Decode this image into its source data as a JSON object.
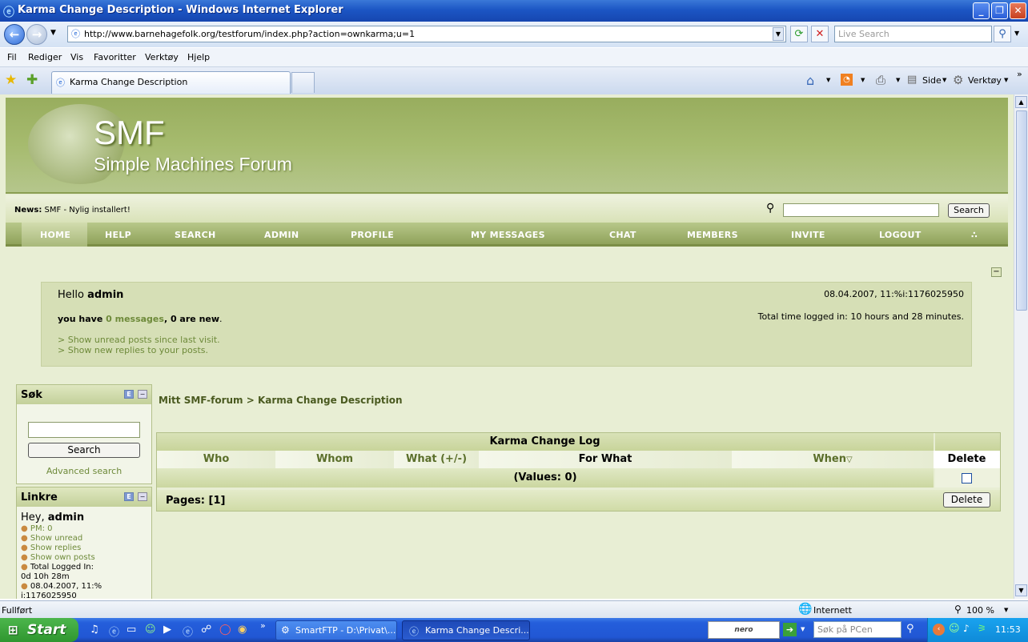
{
  "browser": {
    "title": "Karma Change Description - Windows Internet Explorer",
    "url": "http://www.barnehagefolk.org/testforum/index.php?action=ownkarma;u=1",
    "live_search_placeholder": "Live Search",
    "menu": [
      "Fil",
      "Rediger",
      "Vis",
      "Favoritter",
      "Verktøy",
      "Hjelp"
    ],
    "tab_title": "Karma Change Description",
    "toolbar": {
      "side": "Side",
      "verktoy": "Verktøy"
    },
    "status": "Fullført",
    "zone": "Internett",
    "zoom": "100 %"
  },
  "forum": {
    "logo_title": "SMF",
    "logo_subtitle": "Simple Machines Forum",
    "news_label": "News:",
    "news_text": "SMF - Nylig installert!",
    "search_button": "Search",
    "nav": [
      "HOME",
      "HELP",
      "SEARCH",
      "ADMIN",
      "PROFILE",
      "MY MESSAGES",
      "CHAT",
      "MEMBERS",
      "INVITE",
      "LOGOUT"
    ],
    "user": {
      "hello": "Hello",
      "name": "admin",
      "datetime": "08.04.2007, 11:%i:1176025950",
      "you_have": "you have",
      "messages_link": "0 messages",
      "new_count": ", 0 are new",
      "period": ".",
      "total_time": "Total time logged in: 10 hours and 28 minutes.",
      "unread_link": "> Show unread posts since last visit.",
      "replies_link": "> Show new replies to your posts."
    },
    "sok": {
      "title": "Søk",
      "button": "Search",
      "advanced": "Advanced search"
    },
    "linkre": {
      "title": "Linkre",
      "hey": "Hey,",
      "name": "admin",
      "items": [
        "PM: 0",
        "Show unread",
        "Show replies",
        "Show own posts",
        "Total Logged In:"
      ],
      "logged_time": "0d 10h 28m",
      "date_item": "08.04.2007, 11:%",
      "date_cont": "i:1176025950"
    },
    "breadcrumb": "Mitt SMF-forum > Karma Change Description",
    "karma": {
      "title": "Karma Change Log",
      "columns": [
        "Who",
        "Whom",
        "What (+/-)",
        "For What",
        "When",
        "Delete"
      ],
      "values": "(Values: 0)",
      "pages": "Pages: [1]",
      "delete_button": "Delete"
    }
  },
  "taskbar": {
    "start": "Start",
    "tasks": [
      "SmartFTP - D:\\Privat\\...",
      "Karma Change Descri..."
    ],
    "search_placeholder": "Søk på PCen",
    "clock": "11:53"
  }
}
